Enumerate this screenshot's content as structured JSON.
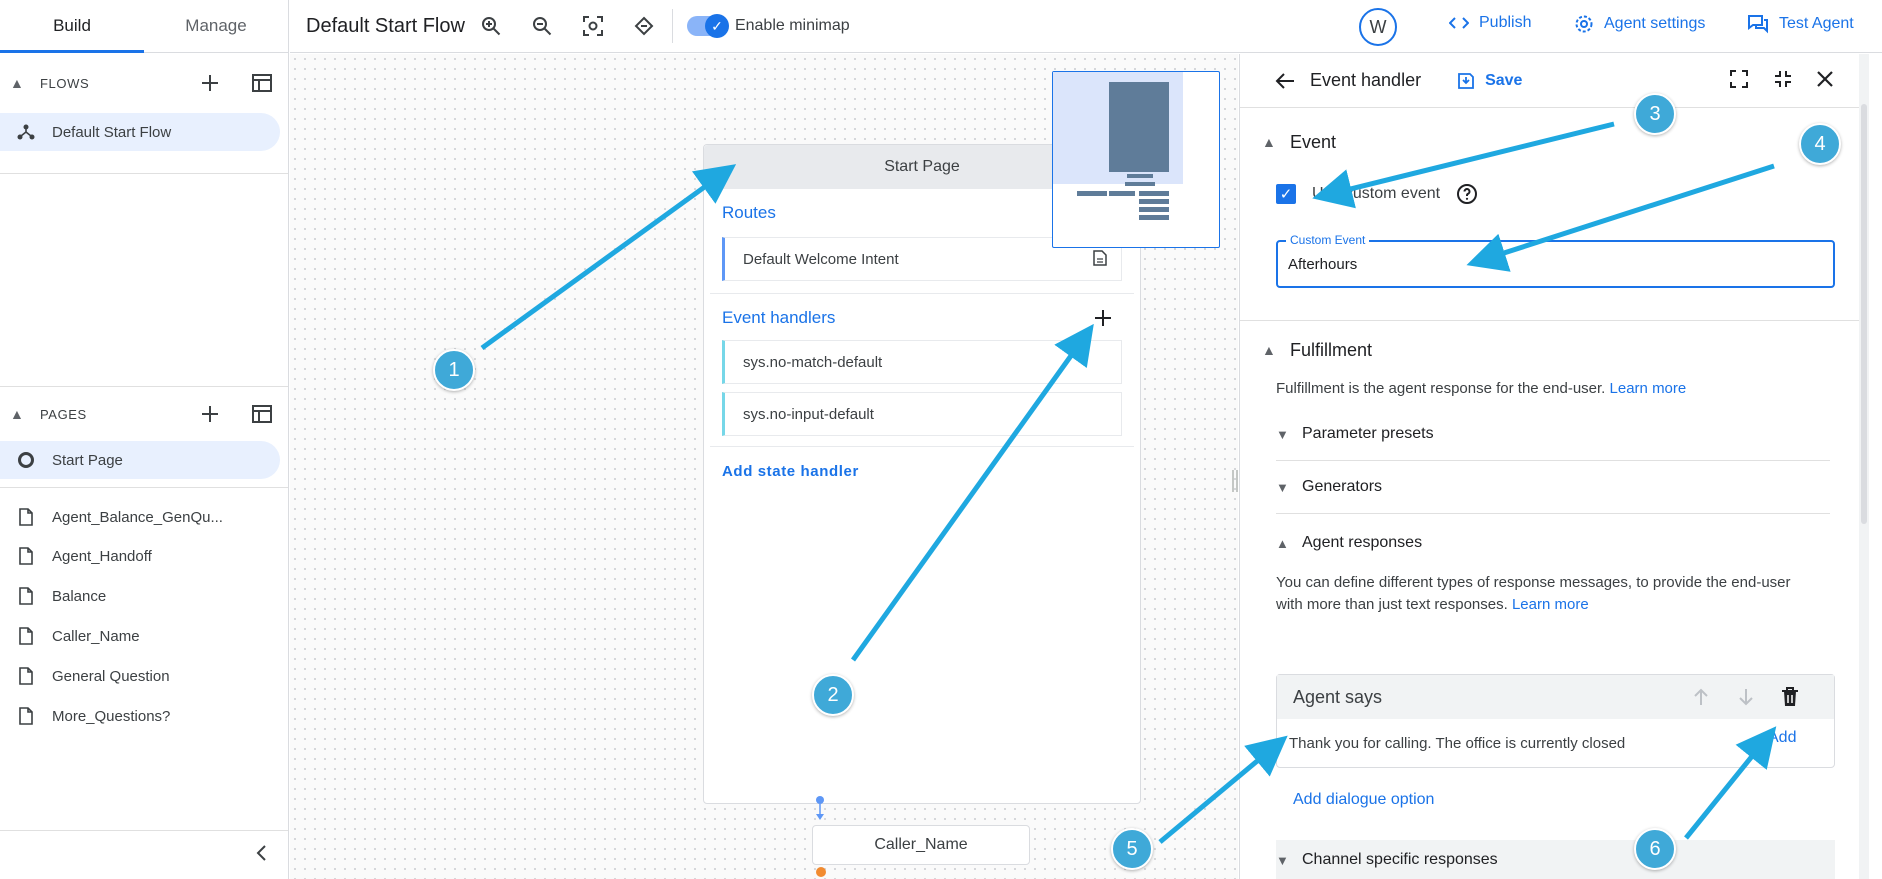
{
  "sidebar": {
    "tabs": [
      "Build",
      "Manage"
    ],
    "flows_title": "FLOWS",
    "flows": [
      "Default Start Flow"
    ],
    "pages_title": "PAGES",
    "selected_page": "Start Page",
    "pages": [
      "Agent_Balance_GenQu...",
      "Agent_Handoff",
      "Balance",
      "Caller_Name",
      "General Question",
      "More_Questions?"
    ]
  },
  "topbar": {
    "flow_title": "Default Start Flow",
    "minimap_label": "Enable minimap",
    "avatar": "W",
    "publish": "Publish",
    "agent_settings": "Agent settings",
    "test_agent": "Test Agent"
  },
  "canvas": {
    "node_title": "Start Page",
    "routes_title": "Routes",
    "route": "Default Welcome Intent",
    "event_handlers_title": "Event handlers",
    "handlers": [
      "sys.no-match-default",
      "sys.no-input-default"
    ],
    "add_state_handler": "Add state handler",
    "next_node": "Caller_Name"
  },
  "panel": {
    "title": "Event handler",
    "save": "Save",
    "event_section": "Event",
    "use_custom_event": "Use custom event",
    "custom_event_label": "Custom Event",
    "custom_event_value": "Afterhours",
    "fulfillment_section": "Fulfillment",
    "fulfillment_desc": "Fulfillment is the agent response for the end-user.",
    "learn_more": "Learn more",
    "parameter_presets": "Parameter presets",
    "generators": "Generators",
    "agent_responses": "Agent responses",
    "responses_desc": "You can define different types of response messages, to provide the end-user with more than just text responses.",
    "agent_says": "Agent says",
    "agent_text": "Thank you for calling. The office is currently closed",
    "add": "Add",
    "add_dialogue_option": "Add dialogue option",
    "channel_specific": "Channel specific responses"
  },
  "callouts": [
    "1",
    "2",
    "3",
    "4",
    "5",
    "6"
  ],
  "colors": {
    "accent": "#1a73e8",
    "callout": "#3fa9d8",
    "selected": "#e8f0fe"
  }
}
